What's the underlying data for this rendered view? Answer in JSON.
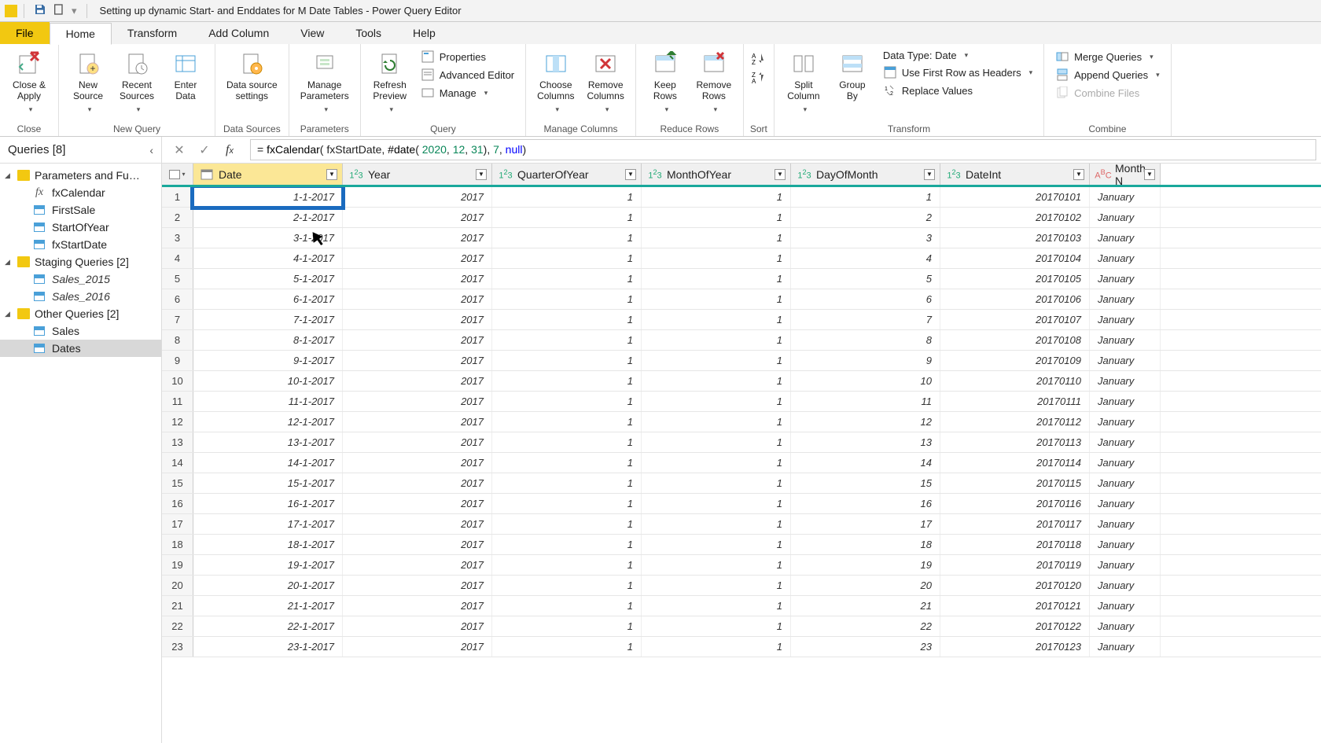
{
  "window_title": "Setting up dynamic Start- and Enddates for M Date Tables - Power Query Editor",
  "menu": {
    "file": "File",
    "home": "Home",
    "transform": "Transform",
    "addcol": "Add Column",
    "view": "View",
    "tools": "Tools",
    "help": "Help"
  },
  "ribbon": {
    "close": {
      "btn": "Close &\nApply",
      "label": "Close"
    },
    "newquery": {
      "new": "New\nSource",
      "recent": "Recent\nSources",
      "enter": "Enter\nData",
      "label": "New Query"
    },
    "datasources": {
      "btn": "Data source\nsettings",
      "label": "Data Sources"
    },
    "parameters": {
      "btn": "Manage\nParameters",
      "label": "Parameters"
    },
    "query": {
      "refresh": "Refresh\nPreview",
      "props": "Properties",
      "adv": "Advanced Editor",
      "manage": "Manage",
      "label": "Query"
    },
    "managecols": {
      "choose": "Choose\nColumns",
      "remove": "Remove\nColumns",
      "label": "Manage Columns"
    },
    "reducerows": {
      "keep": "Keep\nRows",
      "remove": "Remove\nRows",
      "label": "Reduce Rows"
    },
    "sort": {
      "label": "Sort"
    },
    "transform": {
      "split": "Split\nColumn",
      "group": "Group\nBy",
      "datatype": "Data Type: Date",
      "firstrow": "Use First Row as Headers",
      "replace": "Replace Values",
      "label": "Transform"
    },
    "combine": {
      "merge": "Merge Queries",
      "append": "Append Queries",
      "combinefiles": "Combine Files",
      "label": "Combine"
    }
  },
  "queries_header": "Queries [8]",
  "query_groups": [
    {
      "name": "Parameters and Fu…",
      "items": [
        {
          "label": "fxCalendar",
          "type": "fx"
        },
        {
          "label": "FirstSale",
          "type": "tbl"
        },
        {
          "label": "StartOfYear",
          "type": "tbl"
        },
        {
          "label": "fxStartDate",
          "type": "tbl"
        }
      ]
    },
    {
      "name": "Staging Queries [2]",
      "items": [
        {
          "label": "Sales_2015",
          "type": "tbl",
          "italic": true
        },
        {
          "label": "Sales_2016",
          "type": "tbl",
          "italic": true
        }
      ]
    },
    {
      "name": "Other Queries [2]",
      "items": [
        {
          "label": "Sales",
          "type": "tbl"
        },
        {
          "label": "Dates",
          "type": "tbl",
          "selected": true
        }
      ]
    }
  ],
  "formula": {
    "prefix": "= ",
    "fn": "fxCalendar",
    "open": "( ",
    "arg1": "fxStartDate",
    "comma1": ", ",
    "datefn": "#date",
    "dopen": "( ",
    "y": "2020",
    "c1": ", ",
    "m": "12",
    "c2": ", ",
    "d": "31",
    "dclose": ")",
    "comma2": ", ",
    "n1": "7",
    "comma3": ", ",
    "nullkw": "null",
    "close": ")"
  },
  "columns": [
    {
      "key": "Date",
      "label": "Date",
      "type": "date",
      "selected": true,
      "cls": "col-date"
    },
    {
      "key": "Year",
      "label": "Year",
      "type": "num",
      "cls": "col-year"
    },
    {
      "key": "QuarterOfYear",
      "label": "QuarterOfYear",
      "type": "num",
      "cls": "col-quarter"
    },
    {
      "key": "MonthOfYear",
      "label": "MonthOfYear",
      "type": "num",
      "cls": "col-month"
    },
    {
      "key": "DayOfMonth",
      "label": "DayOfMonth",
      "type": "num",
      "cls": "col-day"
    },
    {
      "key": "DateInt",
      "label": "DateInt",
      "type": "num",
      "cls": "col-dateint"
    },
    {
      "key": "MonthName",
      "label": "Month N",
      "type": "text",
      "cls": "col-monthname"
    }
  ],
  "rows": [
    {
      "n": 1,
      "Date": "1-1-2017",
      "Year": "2017",
      "QuarterOfYear": "1",
      "MonthOfYear": "1",
      "DayOfMonth": "1",
      "DateInt": "20170101",
      "MonthName": "January",
      "hl": true
    },
    {
      "n": 2,
      "Date": "2-1-2017",
      "Year": "2017",
      "QuarterOfYear": "1",
      "MonthOfYear": "1",
      "DayOfMonth": "2",
      "DateInt": "20170102",
      "MonthName": "January"
    },
    {
      "n": 3,
      "Date": "3-1-2017",
      "Year": "2017",
      "QuarterOfYear": "1",
      "MonthOfYear": "1",
      "DayOfMonth": "3",
      "DateInt": "20170103",
      "MonthName": "January"
    },
    {
      "n": 4,
      "Date": "4-1-2017",
      "Year": "2017",
      "QuarterOfYear": "1",
      "MonthOfYear": "1",
      "DayOfMonth": "4",
      "DateInt": "20170104",
      "MonthName": "January"
    },
    {
      "n": 5,
      "Date": "5-1-2017",
      "Year": "2017",
      "QuarterOfYear": "1",
      "MonthOfYear": "1",
      "DayOfMonth": "5",
      "DateInt": "20170105",
      "MonthName": "January"
    },
    {
      "n": 6,
      "Date": "6-1-2017",
      "Year": "2017",
      "QuarterOfYear": "1",
      "MonthOfYear": "1",
      "DayOfMonth": "6",
      "DateInt": "20170106",
      "MonthName": "January"
    },
    {
      "n": 7,
      "Date": "7-1-2017",
      "Year": "2017",
      "QuarterOfYear": "1",
      "MonthOfYear": "1",
      "DayOfMonth": "7",
      "DateInt": "20170107",
      "MonthName": "January"
    },
    {
      "n": 8,
      "Date": "8-1-2017",
      "Year": "2017",
      "QuarterOfYear": "1",
      "MonthOfYear": "1",
      "DayOfMonth": "8",
      "DateInt": "20170108",
      "MonthName": "January"
    },
    {
      "n": 9,
      "Date": "9-1-2017",
      "Year": "2017",
      "QuarterOfYear": "1",
      "MonthOfYear": "1",
      "DayOfMonth": "9",
      "DateInt": "20170109",
      "MonthName": "January"
    },
    {
      "n": 10,
      "Date": "10-1-2017",
      "Year": "2017",
      "QuarterOfYear": "1",
      "MonthOfYear": "1",
      "DayOfMonth": "10",
      "DateInt": "20170110",
      "MonthName": "January"
    },
    {
      "n": 11,
      "Date": "11-1-2017",
      "Year": "2017",
      "QuarterOfYear": "1",
      "MonthOfYear": "1",
      "DayOfMonth": "11",
      "DateInt": "20170111",
      "MonthName": "January"
    },
    {
      "n": 12,
      "Date": "12-1-2017",
      "Year": "2017",
      "QuarterOfYear": "1",
      "MonthOfYear": "1",
      "DayOfMonth": "12",
      "DateInt": "20170112",
      "MonthName": "January"
    },
    {
      "n": 13,
      "Date": "13-1-2017",
      "Year": "2017",
      "QuarterOfYear": "1",
      "MonthOfYear": "1",
      "DayOfMonth": "13",
      "DateInt": "20170113",
      "MonthName": "January"
    },
    {
      "n": 14,
      "Date": "14-1-2017",
      "Year": "2017",
      "QuarterOfYear": "1",
      "MonthOfYear": "1",
      "DayOfMonth": "14",
      "DateInt": "20170114",
      "MonthName": "January"
    },
    {
      "n": 15,
      "Date": "15-1-2017",
      "Year": "2017",
      "QuarterOfYear": "1",
      "MonthOfYear": "1",
      "DayOfMonth": "15",
      "DateInt": "20170115",
      "MonthName": "January"
    },
    {
      "n": 16,
      "Date": "16-1-2017",
      "Year": "2017",
      "QuarterOfYear": "1",
      "MonthOfYear": "1",
      "DayOfMonth": "16",
      "DateInt": "20170116",
      "MonthName": "January"
    },
    {
      "n": 17,
      "Date": "17-1-2017",
      "Year": "2017",
      "QuarterOfYear": "1",
      "MonthOfYear": "1",
      "DayOfMonth": "17",
      "DateInt": "20170117",
      "MonthName": "January"
    },
    {
      "n": 18,
      "Date": "18-1-2017",
      "Year": "2017",
      "QuarterOfYear": "1",
      "MonthOfYear": "1",
      "DayOfMonth": "18",
      "DateInt": "20170118",
      "MonthName": "January"
    },
    {
      "n": 19,
      "Date": "19-1-2017",
      "Year": "2017",
      "QuarterOfYear": "1",
      "MonthOfYear": "1",
      "DayOfMonth": "19",
      "DateInt": "20170119",
      "MonthName": "January"
    },
    {
      "n": 20,
      "Date": "20-1-2017",
      "Year": "2017",
      "QuarterOfYear": "1",
      "MonthOfYear": "1",
      "DayOfMonth": "20",
      "DateInt": "20170120",
      "MonthName": "January"
    },
    {
      "n": 21,
      "Date": "21-1-2017",
      "Year": "2017",
      "QuarterOfYear": "1",
      "MonthOfYear": "1",
      "DayOfMonth": "21",
      "DateInt": "20170121",
      "MonthName": "January"
    },
    {
      "n": 22,
      "Date": "22-1-2017",
      "Year": "2017",
      "QuarterOfYear": "1",
      "MonthOfYear": "1",
      "DayOfMonth": "22",
      "DateInt": "20170122",
      "MonthName": "January"
    },
    {
      "n": 23,
      "Date": "23-1-2017",
      "Year": "2017",
      "QuarterOfYear": "1",
      "MonthOfYear": "1",
      "DayOfMonth": "23",
      "DateInt": "20170123",
      "MonthName": "January"
    }
  ]
}
